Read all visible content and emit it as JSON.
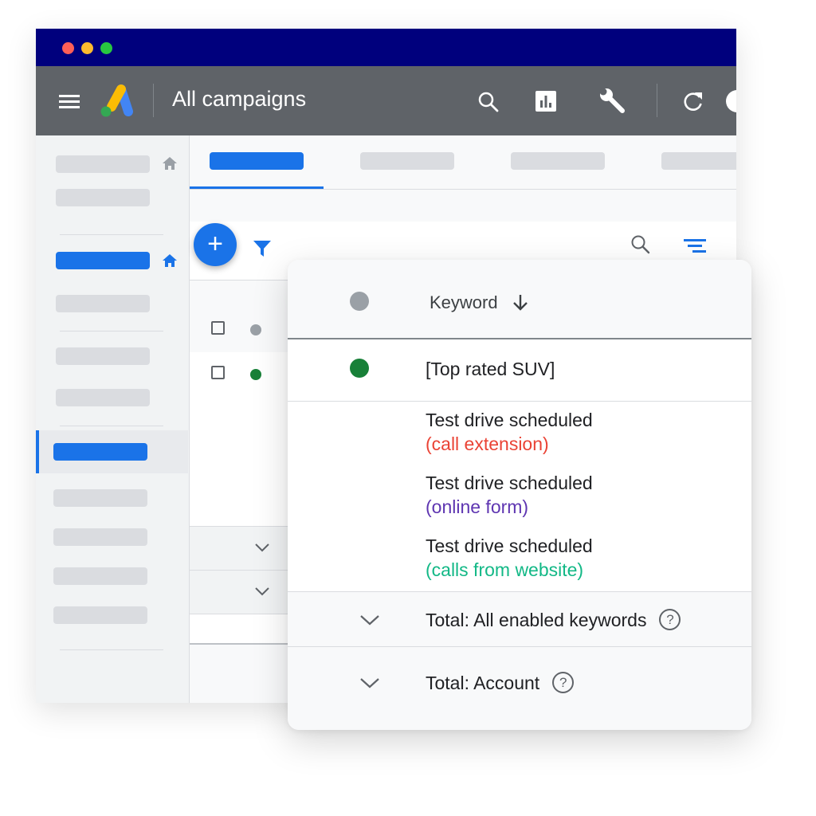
{
  "app": {
    "title": "All campaigns"
  },
  "colors": {
    "titlebar": "#00007d",
    "appbar": "#5f6368",
    "accent_blue": "#1a73e8",
    "status_green": "#188038",
    "status_gray": "#9aa0a6",
    "conv_red": "#ea4335",
    "conv_purple": "#5e35b1",
    "conv_teal": "#12b886"
  },
  "toolbar": {
    "icons": [
      "menu-icon",
      "google-ads-logo",
      "search-icon",
      "reports-icon",
      "tools-icon",
      "refresh-icon",
      "account-icon"
    ]
  },
  "card": {
    "header": {
      "column_label": "Keyword",
      "sort_icon": "arrow-down-icon"
    },
    "keyword_row": {
      "keyword": "[Top rated SUV]"
    },
    "conversions": [
      {
        "action": "Test drive scheduled",
        "source": "(call extension)",
        "color": "#ea4335"
      },
      {
        "action": "Test drive scheduled",
        "source": "(online form)",
        "color": "#5e35b1"
      },
      {
        "action": "Test drive scheduled",
        "source": "(calls from website)",
        "color": "#12b886"
      }
    ],
    "totals": [
      {
        "label": "Total: All enabled keywords"
      },
      {
        "label": "Total: Account"
      }
    ],
    "help_symbol": "?"
  },
  "fab": {
    "label": "+"
  }
}
